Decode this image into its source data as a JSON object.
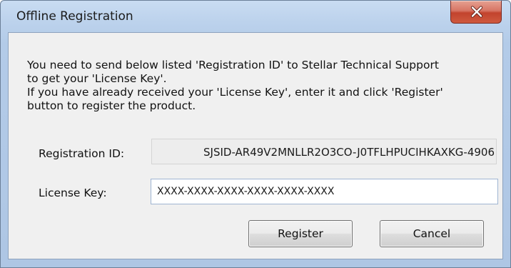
{
  "window": {
    "title": "Offline Registration"
  },
  "message": {
    "line1": "You need to send below listed 'Registration ID' to Stellar Technical Support",
    "line2": "to get your 'License Key'.",
    "line3": "If you have already received your 'License Key', enter it and click 'Register'",
    "line4": "button to register the product."
  },
  "registration": {
    "label": "Registration ID:",
    "value": "SJSID-AR49V2MNLLR2O3CO-J0TFLHPUCIHKAXKG-4906"
  },
  "license": {
    "label": "License Key:",
    "value": "XXXX-XXXX-XXXX-XXXX-XXXX-XXXX"
  },
  "buttons": {
    "register_label": "Register",
    "cancel_label": "Cancel"
  },
  "colors": {
    "title_bar": "#bcd2ec",
    "close_button": "#c2432d",
    "client_area": "#f0f0f0"
  },
  "icons": {
    "close": "close-icon"
  }
}
